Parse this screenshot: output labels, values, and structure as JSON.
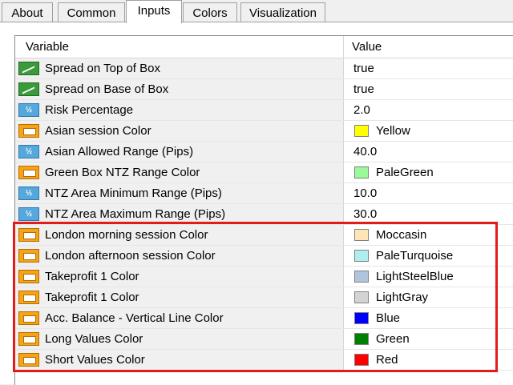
{
  "tabs": [
    {
      "label": "About"
    },
    {
      "label": "Common"
    },
    {
      "label": "Inputs"
    },
    {
      "label": "Colors"
    },
    {
      "label": "Visualization"
    }
  ],
  "active_tab": "Inputs",
  "table": {
    "col_variable": "Variable",
    "col_value": "Value",
    "rows": [
      {
        "icon": "bool-icon",
        "variable": "Spread on Top of Box",
        "value": "true"
      },
      {
        "icon": "bool-icon",
        "variable": "Spread on Base of Box",
        "value": "true"
      },
      {
        "icon": "number-icon",
        "variable": "Risk Percentage",
        "value": "2.0"
      },
      {
        "icon": "color-icon",
        "variable": "Asian session Color",
        "value": "Yellow",
        "swatch": "#ffff00"
      },
      {
        "icon": "number-icon",
        "variable": "Asian Allowed Range (Pips)",
        "value": "40.0"
      },
      {
        "icon": "color-icon",
        "variable": "Green Box NTZ Range Color",
        "value": "PaleGreen",
        "swatch": "#98fb98"
      },
      {
        "icon": "number-icon",
        "variable": "NTZ Area Minimum Range (Pips)",
        "value": "10.0"
      },
      {
        "icon": "number-icon",
        "variable": "NTZ Area Maximum Range (Pips)",
        "value": "30.0"
      },
      {
        "icon": "color-icon",
        "variable": "London morning session Color",
        "value": "Moccasin",
        "swatch": "#ffe4b5"
      },
      {
        "icon": "color-icon",
        "variable": "London afternoon session Color",
        "value": "PaleTurquoise",
        "swatch": "#afeeee"
      },
      {
        "icon": "color-icon",
        "variable": "Takeprofit 1 Color",
        "value": "LightSteelBlue",
        "swatch": "#b0c4de"
      },
      {
        "icon": "color-icon",
        "variable": "Takeprofit 1 Color",
        "value": "LightGray",
        "swatch": "#d3d3d3"
      },
      {
        "icon": "color-icon",
        "variable": "Acc. Balance - Vertical Line Color",
        "value": "Blue",
        "swatch": "#0000ff"
      },
      {
        "icon": "color-icon",
        "variable": "Long Values Color",
        "value": "Green",
        "swatch": "#008000"
      },
      {
        "icon": "color-icon",
        "variable": "Short Values Color",
        "value": "Red",
        "swatch": "#ff0000"
      }
    ]
  },
  "highlight_color": "#e31b1b"
}
